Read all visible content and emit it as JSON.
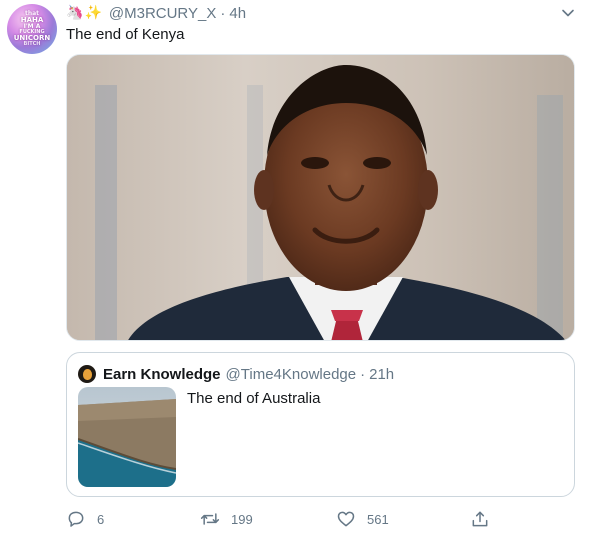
{
  "tweet": {
    "avatar_text": [
      "that",
      "HAHA",
      "I'M A",
      "FUCKING",
      "UNICORN",
      "BITCH"
    ],
    "emoji_unicorn": "🦄",
    "emoji_sparkles": "✨",
    "handle": "@M3RCURY_X",
    "separator": "·",
    "time": "4h",
    "text": "The end of Kenya",
    "menu_icon": "chevron-down-icon"
  },
  "quote": {
    "name": "Earn Knowledge",
    "handle": "@Time4Knowledge",
    "separator": "·",
    "time": "21h",
    "text": "The end of Australia"
  },
  "actions": {
    "reply_count": "6",
    "retweet_count": "199",
    "like_count": "561",
    "icons": [
      "reply-icon",
      "retweet-icon",
      "like-icon",
      "share-icon"
    ]
  },
  "colors": {
    "text_primary": "#14171a",
    "text_secondary": "#657786",
    "border": "#ccd6dd"
  }
}
